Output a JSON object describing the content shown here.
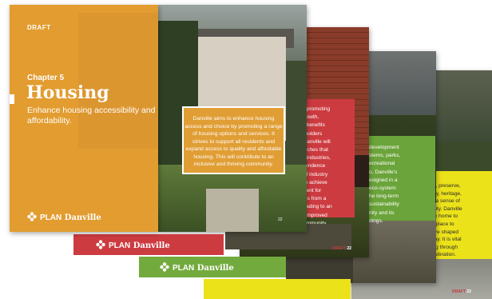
{
  "cover": {
    "draft_label": "DRAFT",
    "chapter": "Chapter 5",
    "title": "Housing",
    "subtitle": "Enhance housing accessibility and affordability.",
    "logo_prefix": "PLAN",
    "logo_name": "Danville"
  },
  "page2": {
    "text": "Danville aims to enhance housing access and choice by promoting a range of housing options and services. It strives to support all residents and expand access to quality and affordable housing. This will contribute to an inclusive and thriving community.",
    "page_number": "22"
  },
  "page3": {
    "lines": [
      "d to promoting",
      "ic growth,",
      "that benefits",
      "job holders",
      "ty. Danville will",
      "proaches that",
      "e of industries,",
      "dependence",
      "ful of industry",
      "ns to achieve",
      "vement for",
      "milies from a",
      "s, leading to an",
      "dily improved",
      "e community."
    ],
    "footer_draft": "DRAFT",
    "footer_page": "22"
  },
  "page4": {
    "lines": [
      "development",
      "stems, parks,",
      "ecreational",
      "o, Danville's",
      "esigned in a",
      "eco-system",
      "he long-term",
      "sustainability",
      "nity and its",
      "dings."
    ]
  },
  "page5": {
    "lines": [
      "or, preserve,",
      "ory, heritage,",
      "g a sense of",
      "ntity. Danville",
      "en home to",
      "d place to",
      "ave shaped",
      "day. It is vital",
      "ing through",
      "elebration."
    ],
    "footer_draft": "DRAFT",
    "footer_page": "22"
  },
  "strips": {
    "red_logo_prefix": "PLAN",
    "red_logo_name": "Danville",
    "green_logo_prefix": "PLAN",
    "green_logo_name": "Danville"
  },
  "colors": {
    "orange": "#e29c2f",
    "red": "#cc3b40",
    "green": "#6ba43a",
    "yellow": "#ece21a"
  }
}
